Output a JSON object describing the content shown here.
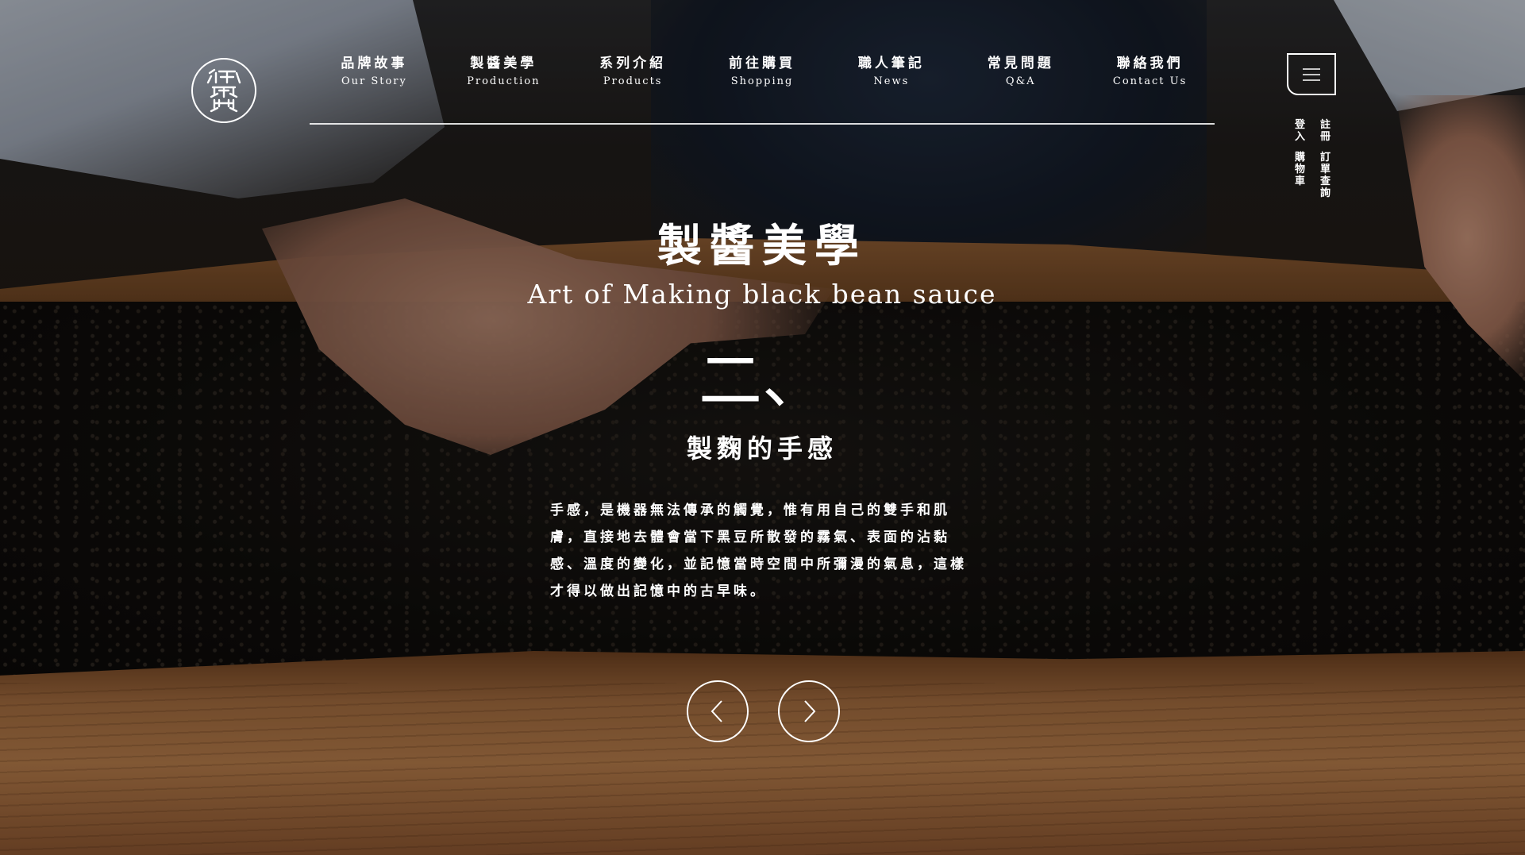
{
  "header": {
    "logo_alt": "御鼎興",
    "nav": [
      {
        "zh": "品牌故事",
        "en": "Our Story"
      },
      {
        "zh": "製醬美學",
        "en": "Production"
      },
      {
        "zh": "系列介紹",
        "en": "Products"
      },
      {
        "zh": "前往購買",
        "en": "Shopping"
      },
      {
        "zh": "職人筆記",
        "en": "News"
      },
      {
        "zh": "常見問題",
        "en": "Q&A"
      },
      {
        "zh": "聯絡我們",
        "en": "Contact Us"
      }
    ],
    "side_links": {
      "login": "登入",
      "register": "註冊",
      "cart": "購物車",
      "order_lookup": "訂單查詢"
    }
  },
  "hero": {
    "title": "製醬美學",
    "subtitle": "Art of Making black bean sauce",
    "step_number": "二、",
    "step_title": "製麴的手感",
    "body": "手感，是機器無法傳承的觸覺，惟有用自己的雙手和肌膚，直接地去體會當下黑豆所散發的霧氣、表面的沾黏感、溫度的變化，並記憶當時空間中所彌漫的氣息，這樣才得以做出記憶中的古早味。"
  },
  "icons": {
    "menu": "hamburger-icon",
    "prev": "chevron-left-icon",
    "next": "chevron-right-icon"
  }
}
